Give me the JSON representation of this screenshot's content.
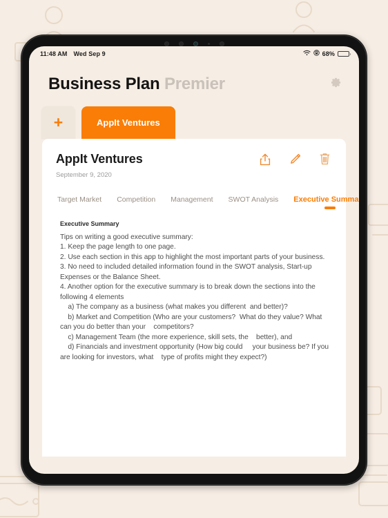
{
  "status_bar": {
    "time": "11:48 AM",
    "date": "Wed Sep 9",
    "battery_percent": "68%",
    "wifi_icon": "wifi-icon",
    "orientation_lock_icon": "orientation-lock-icon",
    "battery_icon": "battery-icon"
  },
  "header": {
    "title_main": "Business Plan",
    "title_suffix": "Premier",
    "settings_icon": "gear-icon"
  },
  "doc_tabs": {
    "add_label": "+",
    "items": [
      {
        "label": "AppIt Ventures",
        "active": true
      }
    ]
  },
  "card": {
    "title": "AppIt Ventures",
    "date": "September 9, 2020",
    "actions": [
      {
        "name": "share-icon",
        "label": "Share"
      },
      {
        "name": "edit-pencil-icon",
        "label": "Edit"
      },
      {
        "name": "trash-icon",
        "label": "Delete"
      }
    ],
    "section_tabs": [
      {
        "label": "Target Market",
        "active": false
      },
      {
        "label": "Competition",
        "active": false
      },
      {
        "label": "Management",
        "active": false
      },
      {
        "label": "SWOT Analysis",
        "active": false
      },
      {
        "label": "Executive Summary",
        "active": true
      }
    ],
    "content": {
      "heading": "Executive Summary",
      "body": "Tips on writing a good executive summary:\n1. Keep the page length to one page.\n2. Use each section in this app to highlight the most important parts of your business.\n3. No need to included detailed information found in the SWOT analysis, Start-up Expenses or the Balance Sheet.\n4. Another option for the executive summary is to break down the sections into the following 4 elements\n    a) The company as a business (what makes you different  and better)?\n    b) Market and Competition (Who are your customers?  What do they value? What can you do better than your    competitors?\n    c) Management Team (the more experience, skill sets, the    better), and\n    d) Financials and investment opportunity (How big could     your business be? If you are looking for investors, what    type of profits might they expect?)"
    }
  },
  "colors": {
    "accent": "#f97d06",
    "page_background": "#f6ede4",
    "card_background": "#ffffff",
    "device_frame": "#121212",
    "muted_text": "#9a8f85"
  }
}
